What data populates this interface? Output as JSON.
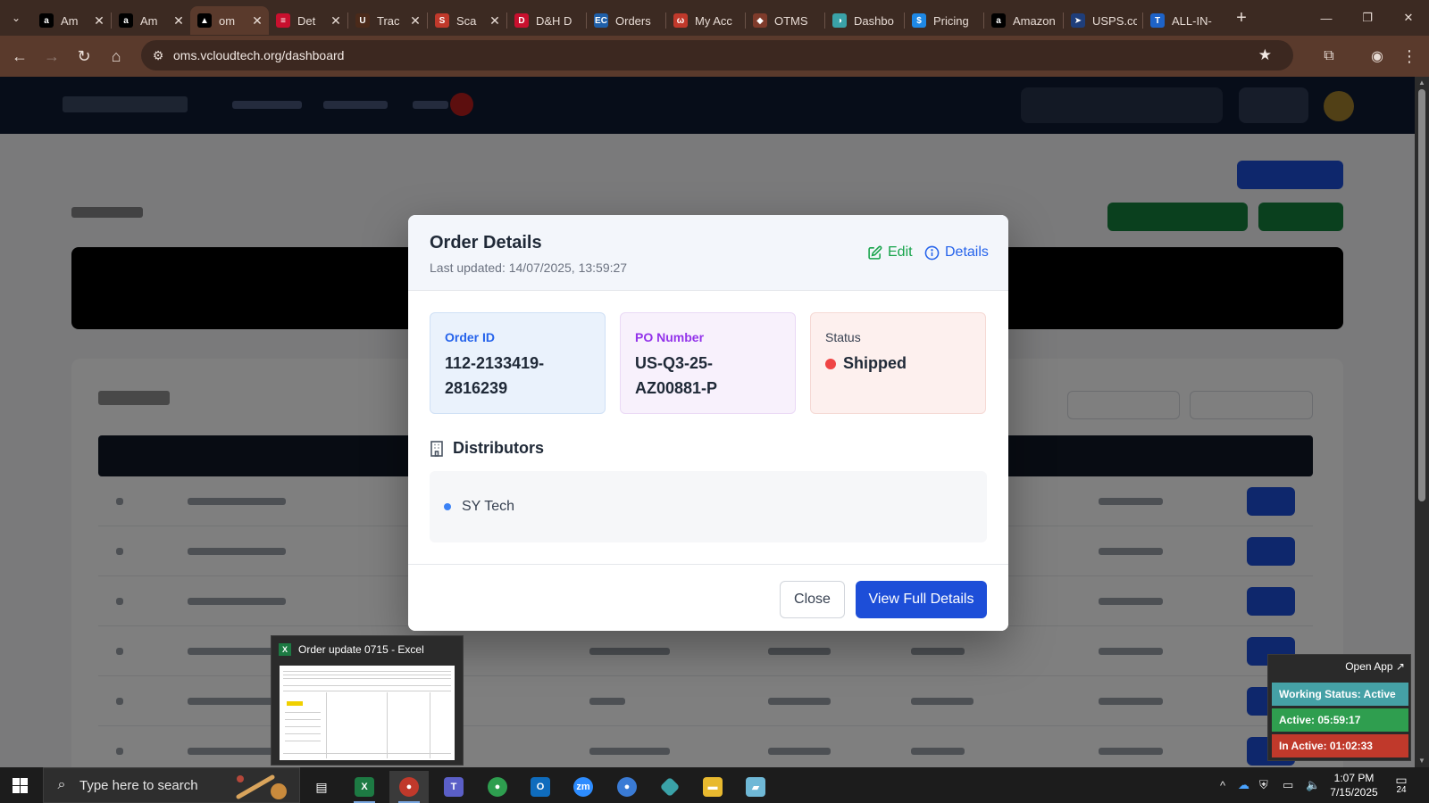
{
  "browser": {
    "tabs": [
      {
        "title": "Am",
        "icon": "amazon-icon",
        "color": "#000000",
        "glyph": "a"
      },
      {
        "title": "Am",
        "icon": "amazon-icon",
        "color": "#000000",
        "glyph": "a"
      },
      {
        "title": "om",
        "icon": "oms-icon",
        "color": "#000000",
        "glyph": "▲",
        "active": true
      },
      {
        "title": "Det",
        "icon": "tracking-icon",
        "color": "#c8102e",
        "glyph": "≡"
      },
      {
        "title": "Trac",
        "icon": "ups-icon",
        "color": "#4b2a1a",
        "glyph": "U"
      },
      {
        "title": "Sca",
        "icon": "scan-icon",
        "color": "#c0392b",
        "glyph": "S"
      },
      {
        "title": "D&H D",
        "icon": "dh-icon",
        "color": "#c8102e",
        "glyph": "D"
      },
      {
        "title": "Orders",
        "icon": "ec-icon",
        "color": "#1f5fa8",
        "glyph": "EC"
      },
      {
        "title": "My Acc",
        "icon": "account-icon",
        "color": "#c0392b",
        "glyph": "ω"
      },
      {
        "title": "OTMS",
        "icon": "otms-icon",
        "color": "#7f3b2b",
        "glyph": "◆"
      },
      {
        "title": "Dashbo",
        "icon": "dashboard-icon",
        "color": "#3aa2a8",
        "glyph": "◑"
      },
      {
        "title": "Pricing",
        "icon": "pricing-icon",
        "color": "#1e88e5",
        "glyph": "$"
      },
      {
        "title": "Amazon",
        "icon": "amazon-icon",
        "color": "#000000",
        "glyph": "a"
      },
      {
        "title": "USPS.co",
        "icon": "usps-icon",
        "color": "#1f3e7a",
        "glyph": "➤"
      },
      {
        "title": "ALL-IN-",
        "icon": "allin-icon",
        "color": "#1e63c8",
        "glyph": "T"
      }
    ],
    "url": "oms.vcloudtech.org/dashboard"
  },
  "modal": {
    "title": "Order Details",
    "updated": "Last updated: 14/07/2025, 13:59:27",
    "edit_label": "Edit",
    "details_label": "Details",
    "order_id_label": "Order ID",
    "order_id_value": "112-2133419-2816239",
    "po_label": "PO Number",
    "po_value": "US-Q3-25-AZ00881-P",
    "status_label": "Status",
    "status_value": "Shipped",
    "status_color": "#ef4444",
    "distributors_label": "Distributors",
    "distributors": [
      "SY Tech"
    ],
    "close_label": "Close",
    "view_full_label": "View Full Details"
  },
  "excel_preview": {
    "title": "Order update 0715 - Excel"
  },
  "tracker": {
    "open_app": "Open App ↗",
    "working_status": "Working Status: Active",
    "active": "Active: 05:59:17",
    "inactive": "In Active: 01:02:33"
  },
  "taskbar": {
    "search_placeholder": "Type here to search",
    "time": "1:07 PM",
    "date": "7/15/2025",
    "notification_count": "24"
  }
}
